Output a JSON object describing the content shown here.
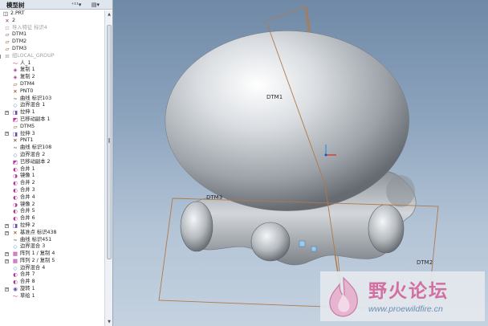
{
  "tree": {
    "title": "模型树",
    "btn_settings": "⁺¹¹▾",
    "btn_show": "▤▾",
    "rows": [
      {
        "label": "2.PRT",
        "indent": 0,
        "icon": "part-icon",
        "glyph": "◫",
        "color": "#2a2a2a",
        "exp": ""
      },
      {
        "label": "2",
        "indent": 2,
        "icon": "coordinate-system-icon",
        "glyph": "✕",
        "color": "#9b3b8a",
        "exp": ""
      },
      {
        "label": "导入特征 标识4",
        "indent": 2,
        "icon": "import-feature-icon",
        "glyph": "⊡",
        "color": "#b0b0b0",
        "exp": "",
        "dim": true
      },
      {
        "label": "DTM1",
        "indent": 2,
        "icon": "datum-plane-icon",
        "glyph": "▱",
        "color": "#7a3f1a",
        "exp": ""
      },
      {
        "label": "DTM2",
        "indent": 2,
        "icon": "datum-plane-icon",
        "glyph": "▱",
        "color": "#7a3f1a",
        "exp": ""
      },
      {
        "label": "DTM3",
        "indent": 2,
        "icon": "datum-plane-icon",
        "glyph": "▱",
        "color": "#7a3f1a",
        "exp": ""
      },
      {
        "label": "组LOCAL_GROUP",
        "indent": 2,
        "icon": "group-icon",
        "glyph": "⊞",
        "color": "#a6a6a6",
        "exp": "−",
        "dim": true
      },
      {
        "label": "人_1",
        "indent": 12,
        "icon": "sketch-icon",
        "glyph": "〜",
        "color": "#c03060",
        "exp": ""
      },
      {
        "label": "复制 1",
        "indent": 12,
        "icon": "copy-icon",
        "glyph": "◈",
        "color": "#b0389a",
        "exp": ""
      },
      {
        "label": "复制 2",
        "indent": 12,
        "icon": "copy-icon",
        "glyph": "◈",
        "color": "#b0389a",
        "exp": ""
      },
      {
        "label": "DTM4",
        "indent": 12,
        "icon": "datum-plane-icon",
        "glyph": "▱",
        "color": "#7a3f1a",
        "exp": ""
      },
      {
        "label": "PNT0",
        "indent": 12,
        "icon": "datum-point-icon",
        "glyph": "✕",
        "color": "#7a3f1a",
        "exp": ""
      },
      {
        "label": "曲线 标识103",
        "indent": 12,
        "icon": "curve-icon",
        "glyph": "∼",
        "color": "#1a1a1a",
        "exp": ""
      },
      {
        "label": "边界混合 1",
        "indent": 12,
        "icon": "boundary-blend-icon",
        "glyph": "◇",
        "color": "#4080c0",
        "exp": ""
      },
      {
        "label": "拉伸 1",
        "indent": 12,
        "icon": "extrude-icon",
        "glyph": "◨",
        "color": "#6a4aa8",
        "exp": "+"
      },
      {
        "label": "已移动副本 1",
        "indent": 12,
        "icon": "moved-copy-icon",
        "glyph": "◩",
        "color": "#b0389a",
        "exp": ""
      },
      {
        "label": "DTM5",
        "indent": 12,
        "icon": "datum-plane-icon",
        "glyph": "▱",
        "color": "#7a3f1a",
        "exp": ""
      },
      {
        "label": "拉伸 3",
        "indent": 12,
        "icon": "extrude-icon",
        "glyph": "◨",
        "color": "#6a4aa8",
        "exp": "+"
      },
      {
        "label": "PNT1",
        "indent": 12,
        "icon": "datum-point-icon",
        "glyph": "✕",
        "color": "#7a3f1a",
        "exp": ""
      },
      {
        "label": "曲线 标识108",
        "indent": 12,
        "icon": "curve-icon",
        "glyph": "∼",
        "color": "#1a1a1a",
        "exp": ""
      },
      {
        "label": "边界混合 2",
        "indent": 12,
        "icon": "boundary-blend-icon",
        "glyph": "◇",
        "color": "#4080c0",
        "exp": ""
      },
      {
        "label": "已移动副本 2",
        "indent": 12,
        "icon": "moved-copy-icon",
        "glyph": "◩",
        "color": "#b0389a",
        "exp": ""
      },
      {
        "label": "合并 1",
        "indent": 12,
        "icon": "merge-icon",
        "glyph": "◐",
        "color": "#b0389a",
        "exp": ""
      },
      {
        "label": "镜像 1",
        "indent": 12,
        "icon": "mirror-icon",
        "glyph": "◑",
        "color": "#b0389a",
        "exp": ""
      },
      {
        "label": "合并 2",
        "indent": 12,
        "icon": "merge-icon",
        "glyph": "◐",
        "color": "#b0389a",
        "exp": ""
      },
      {
        "label": "合并 3",
        "indent": 12,
        "icon": "merge-icon",
        "glyph": "◐",
        "color": "#b0389a",
        "exp": ""
      },
      {
        "label": "合并 4",
        "indent": 12,
        "icon": "merge-icon",
        "glyph": "◐",
        "color": "#b0389a",
        "exp": ""
      },
      {
        "label": "镜像 2",
        "indent": 12,
        "icon": "mirror-icon",
        "glyph": "◑",
        "color": "#b0389a",
        "exp": ""
      },
      {
        "label": "合并 5",
        "indent": 12,
        "icon": "merge-icon",
        "glyph": "◐",
        "color": "#b0389a",
        "exp": ""
      },
      {
        "label": "合并 6",
        "indent": 12,
        "icon": "merge-icon",
        "glyph": "◐",
        "color": "#b0389a",
        "exp": ""
      },
      {
        "label": "拉伸 2",
        "indent": 12,
        "icon": "extrude-icon",
        "glyph": "◨",
        "color": "#6a4aa8",
        "exp": "+"
      },
      {
        "label": "基准点 标识438",
        "indent": 12,
        "icon": "datum-point-icon",
        "glyph": "✕",
        "color": "#7a3f1a",
        "exp": "+"
      },
      {
        "label": "曲线 标识451",
        "indent": 12,
        "icon": "curve-icon",
        "glyph": "∼",
        "color": "#1a1a1a",
        "exp": ""
      },
      {
        "label": "边界混合 3",
        "indent": 12,
        "icon": "boundary-blend-icon",
        "glyph": "◇",
        "color": "#4080c0",
        "exp": ""
      },
      {
        "label": "阵列 1 / 复制 4",
        "indent": 12,
        "icon": "pattern-icon",
        "glyph": "▦",
        "color": "#b0389a",
        "exp": "+"
      },
      {
        "label": "阵列 2 / 复制 5",
        "indent": 12,
        "icon": "pattern-icon",
        "glyph": "▦",
        "color": "#b0389a",
        "exp": "+"
      },
      {
        "label": "边界混合 4",
        "indent": 12,
        "icon": "boundary-blend-icon",
        "glyph": "◇",
        "color": "#4080c0",
        "exp": ""
      },
      {
        "label": "合并 7",
        "indent": 12,
        "icon": "merge-icon",
        "glyph": "◐",
        "color": "#b0389a",
        "exp": ""
      },
      {
        "label": "合并 8",
        "indent": 12,
        "icon": "merge-icon",
        "glyph": "◐",
        "color": "#b0389a",
        "exp": ""
      },
      {
        "label": "旋转 1",
        "indent": 12,
        "icon": "revolve-icon",
        "glyph": "◉",
        "color": "#6a4aa8",
        "exp": "+"
      },
      {
        "label": "草绘 1",
        "indent": 12,
        "icon": "sketch-icon",
        "glyph": "〜",
        "color": "#c03060",
        "exp": ""
      }
    ]
  },
  "viewport": {
    "plane_labels": {
      "dtm1_top": "DTM1",
      "dtm1_left": "DTM3",
      "dtm2": "DTM2"
    },
    "colors": {
      "plane": "#b07a4a",
      "shape": "#c9cdd1",
      "shape_shadow": "#5f6469"
    }
  },
  "watermark": {
    "text": "野火论坛",
    "url": "www.proewildfire.cn",
    "color": "#d36fa0"
  }
}
